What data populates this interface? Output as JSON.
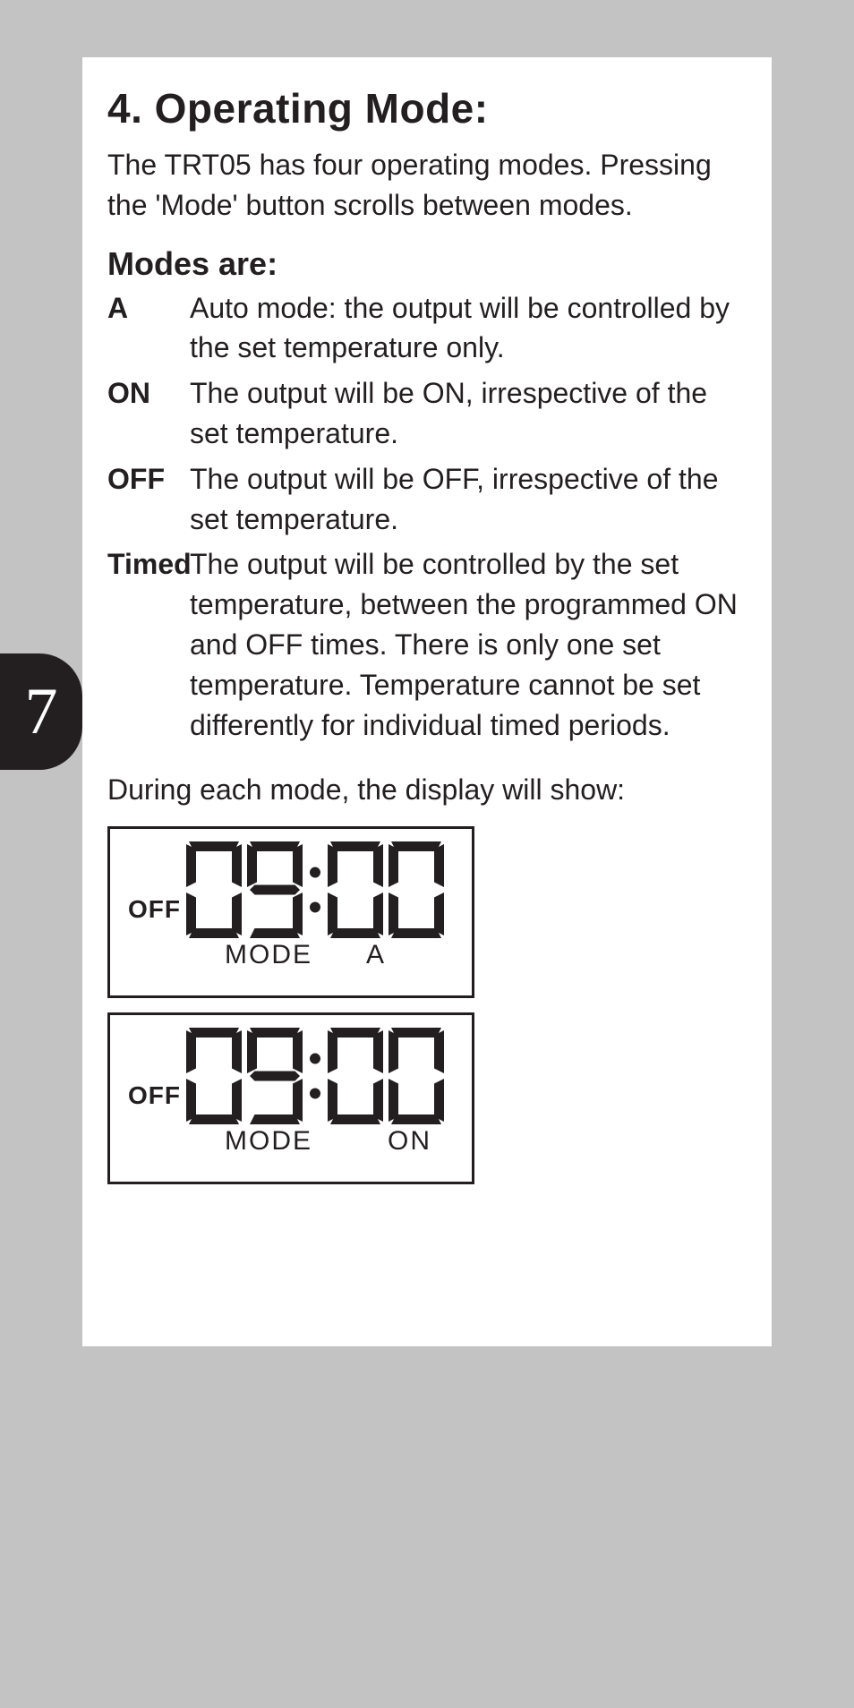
{
  "page_number": "7",
  "title": "4. Operating Mode:",
  "intro": "The TRT05 has four operating modes. Pressing the 'Mode' button scrolls between modes.",
  "modes_heading": "Modes are:",
  "modes": [
    {
      "label": "A",
      "desc": "Auto mode: the output will be controlled by the set temperature only."
    },
    {
      "label": "ON",
      "desc": "The output will be ON, irrespective of the set temperature."
    },
    {
      "label": "OFF",
      "desc": "The output will be OFF, irrespective of the set temperature."
    },
    {
      "label": "Timed",
      "desc": "The output will be controlled by the set temperature, between the programmed ON and OFF times. There is only one set temperature. Temperature cannot be set differently for individual timed periods."
    }
  ],
  "during_text": "During each mode, the display will show:",
  "lcd_panels": [
    {
      "status": "OFF",
      "time": "09:00",
      "mode_label": "MODE",
      "mode_value": "A"
    },
    {
      "status": "OFF",
      "time": "09:00",
      "mode_label": "MODE",
      "mode_value": "ON"
    }
  ]
}
